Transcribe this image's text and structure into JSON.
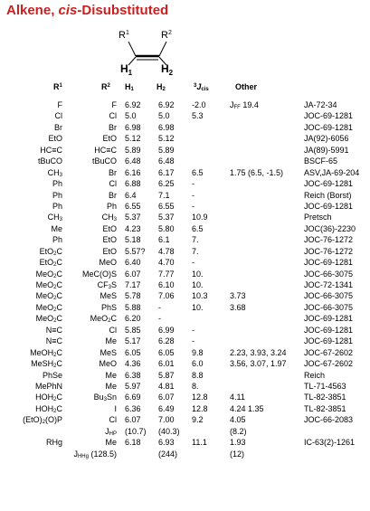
{
  "title": {
    "prefix": "Alkene, ",
    "italic": "cis",
    "suffix": "-Disubstituted"
  },
  "structure": {
    "r1": "R",
    "r1_sup": "1",
    "r2": "R",
    "r2_sup": "2",
    "h1": "H",
    "h1_sub": "1",
    "h2": "H",
    "h2_sub": "2"
  },
  "headers": {
    "r1": "R",
    "r1_sup": "1",
    "r2": "R",
    "r2_sup": "2",
    "h1": "H",
    "h1_sub": "1",
    "h2": "H",
    "h2_sub": "2",
    "j_sup": "3",
    "j": "J",
    "j_sub": "cis",
    "other": "Other"
  },
  "rows": [
    {
      "r1": "F",
      "r2": "F",
      "h1": "6.92",
      "h2": "6.92",
      "j": "-2.0",
      "other": "J_FF 19.4",
      "ref": "JA-72-34"
    },
    {
      "r1": "Cl",
      "r2": "Cl",
      "h1": "5.0",
      "h2": "5.0",
      "j": "5.3",
      "other": "",
      "ref": "JOC-69-1281"
    },
    {
      "r1": "Br",
      "r2": "Br",
      "h1": "6.98",
      "h2": "6.98",
      "j": "",
      "other": "",
      "ref": "JOC-69-1281"
    },
    {
      "r1": "EtO",
      "r2": "EtO",
      "h1": "5.12",
      "h2": "5.12",
      "j": "",
      "other": "",
      "ref": "JA(92)-6056"
    },
    {
      "r1": "HC≡C",
      "r2": "HC≡C",
      "h1": "5.89",
      "h2": "5.89",
      "j": "",
      "other": "",
      "ref": "JA(89)-5991"
    },
    {
      "r1": "tBuCO",
      "r2": "tBuCO",
      "h1": "6.48",
      "h2": "6.48",
      "j": "",
      "other": "",
      "ref": "BSCF-65"
    },
    {
      "r1": "CH_3",
      "r2": "Br",
      "h1": "6.16",
      "h2": "6.17",
      "j": "6.5",
      "other": "1.75 (6.5, -1.5)",
      "ref": "ASV,JA-69-204"
    },
    {
      "r1": "Ph",
      "r2": "Cl",
      "h1": "6.88",
      "h2": "6.25",
      "j": "-",
      "other": "",
      "ref": "JOC-69-1281"
    },
    {
      "r1": "Ph",
      "r2": "Br",
      "h1": "6.4",
      "h2": "7.1",
      "j": "-",
      "other": "",
      "ref": "Reich (Borst)"
    },
    {
      "r1": "Ph",
      "r2": "Ph",
      "h1": "6.55",
      "h2": "6.55",
      "j": "-",
      "other": "",
      "ref": "JOC-69-1281"
    },
    {
      "r1": "CH_3",
      "r2": "CH_3",
      "h1": "5.37",
      "h2": "5.37",
      "j": "10.9",
      "other": "",
      "ref": "Pretsch"
    },
    {
      "r1": "Me",
      "r2": "EtO",
      "h1": "4.23",
      "h2": "5.80",
      "j": "6.5",
      "other": "",
      "ref": "JOC(36)-2230"
    },
    {
      "r1": "Ph",
      "r2": "EtO",
      "h1": "5.18",
      "h2": "6.1",
      "j": "7.",
      "other": "",
      "ref": "JOC-76-1272"
    },
    {
      "r1": "EtO_2C",
      "r2": "EtO",
      "h1": "5.57?",
      "h2": "4.78",
      "j": "7.",
      "other": "",
      "ref": "JOC-76-1272"
    },
    {
      "r1": "EtO_2C",
      "r2": "MeO",
      "h1": "6.40",
      "h2": "4.70",
      "j": "-",
      "other": "",
      "ref": "JOC-69-1281"
    },
    {
      "r1": "MeO_2C",
      "r2": "MeC(O)S",
      "h1": "6.07",
      "h2": "7.77",
      "j": "10.",
      "other": "",
      "ref": "JOC-66-3075"
    },
    {
      "r1": "MeO_2C",
      "r2": "CF_3S",
      "h1": "7.17",
      "h2": "6.10",
      "j": "10.",
      "other": "",
      "ref": "JOC-72-1341"
    },
    {
      "r1": "MeO_2C",
      "r2": "MeS",
      "h1": "5.78",
      "h2": "7.06",
      "j": "10.3",
      "other": "3.73",
      "ref": "JOC-66-3075"
    },
    {
      "r1": "MeO_2C",
      "r2": "PhS",
      "h1": "5.88",
      "h2": "-",
      "j": "10.",
      "other": "3.68",
      "ref": "JOC-66-3075"
    },
    {
      "r1": "MeO_2C",
      "r2": "MeO_2C",
      "h1": "6.20",
      "h2": "-",
      "j": "",
      "other": "",
      "ref": "JOC-69-1281"
    },
    {
      "r1": "N≡C",
      "r2": "Cl",
      "h1": "5.85",
      "h2": "6.99",
      "j": "-",
      "other": "",
      "ref": "JOC-69-1281"
    },
    {
      "r1": "N≡C",
      "r2": "Me",
      "h1": "5.17",
      "h2": "6.28",
      "j": "-",
      "other": "",
      "ref": "JOC-69-1281"
    },
    {
      "r1": "MeOH_2C",
      "r2": "MeS",
      "h1": "6.05",
      "h2": "6.05",
      "j": "9.8",
      "other": "2.23, 3.93, 3.24",
      "ref": "JOC-67-2602"
    },
    {
      "r1": "MeSH_2C",
      "r2": "MeO",
      "h1": "4.36",
      "h2": "6.01",
      "j": "6.0",
      "other": "3.56, 3.07, 1.97",
      "ref": "JOC-67-2602"
    },
    {
      "r1": "PhSe",
      "r2": "Me",
      "h1": "6.38",
      "h2": "5.87",
      "j": "8.8",
      "other": "",
      "ref": "Reich"
    },
    {
      "r1": "MePhN",
      "r2": "Me",
      "h1": "5.97",
      "h2": "4.81",
      "j": "8.",
      "other": "",
      "ref": "TL-71-4563"
    },
    {
      "r1": "HOH_2C",
      "r2": "Bu_3Sn",
      "h1": "6.69",
      "h2": "6.07",
      "j": "12.8",
      "other": "4.11",
      "ref": "TL-82-3851"
    },
    {
      "r1": "HOH_2C",
      "r2": "I",
      "h1": "6.36",
      "h2": "6.49",
      "j": "12.8",
      "other": "4.24  1.35",
      "ref": "TL-82-3851"
    },
    {
      "r1": "(EtO)_2(O)P",
      "r2": "Cl",
      "h1": "6.07",
      "h2": "7.00",
      "j": "9.2",
      "other": "4.05",
      "ref": "JOC-66-2083"
    },
    {
      "r1": "",
      "r2": "J_HP",
      "h1": "(10.7)",
      "h2": "(40.3)",
      "j": "",
      "other": "(8.2)",
      "ref": ""
    },
    {
      "r1": "RHg",
      "r2": "Me",
      "h1": "6.18",
      "h2": "6.93",
      "j": "11.1",
      "other": "1.93",
      "ref": "IC-63(2)-1261"
    },
    {
      "r1": "",
      "r2": "J_HHg (128.5)",
      "h1": "",
      "h2": "(244)",
      "j": "",
      "other": "(12)",
      "ref": ""
    }
  ]
}
